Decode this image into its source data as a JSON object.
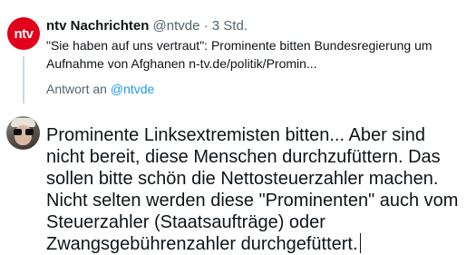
{
  "original_tweet": {
    "avatar_text": "ntv",
    "author_name": "ntv Nachrichten",
    "author_handle": "@ntvde",
    "separator": " · ",
    "time": "3 Std.",
    "text_line1": "\"Sie haben auf uns vertraut\": Prominente bitten Bundesregierung um",
    "text_line2": "Aufnahme von Afghanen n-tv.de/politik/Promin..."
  },
  "reply_context": {
    "prefix": "Antwort an ",
    "handle": "@ntvde"
  },
  "composer": {
    "text": "Prominente Linksextremisten bitten... Aber sind nicht bereit, diese Menschen durchzufüttern. Das sollen bitte schön die Nettosteuerzahler machen. Nicht selten werden diese \"Prominenten\" auch vom Steuerzahler (Staatsaufträge) oder Zwangsgebührenzahler durchgefüttert."
  },
  "colors": {
    "ntv_brand": "#e2001a",
    "link": "#1d9bf0",
    "secondary_text": "#536471"
  }
}
